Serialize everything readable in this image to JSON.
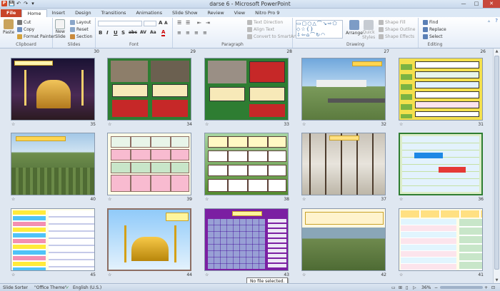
{
  "window": {
    "title": "darse 6  -  Microsoft PowerPoint"
  },
  "qat": [
    "P",
    "💾",
    "↶",
    "↷",
    "▾"
  ],
  "tabs": [
    "File",
    "Home",
    "Insert",
    "Design",
    "Transitions",
    "Animations",
    "Slide Show",
    "Review",
    "View",
    "Nitro Pro 9"
  ],
  "ribbon": {
    "clipboard": {
      "paste": "Paste",
      "cut": "Cut",
      "copy": "Copy",
      "format_painter": "Format Painter",
      "label": "Clipboard"
    },
    "slides": {
      "new_slide": "New",
      "new_slide2": "Slide",
      "layout": "Layout",
      "reset": "Reset",
      "section": "Section",
      "label": "Slides"
    },
    "font": {
      "bold": "B",
      "italic": "I",
      "underline": "U",
      "shadow": "S",
      "strike": "abc",
      "spacing": "AV",
      "case": "Aa",
      "color": "A",
      "label": "Font"
    },
    "paragraph": {
      "text_direction": "Text Direction",
      "align_text": "Align Text",
      "smartart": "Convert to SmartArt",
      "label": "Paragraph"
    },
    "drawing": {
      "arrange": "Arrange",
      "quick_styles": "Quick",
      "quick_styles2": "Styles",
      "shape_fill": "Shape Fill",
      "shape_outline": "Shape Outline",
      "shape_effects": "Shape Effects",
      "label": "Drawing"
    },
    "editing": {
      "find": "Find",
      "replace": "Replace",
      "select": "Select",
      "label": "Editing"
    }
  },
  "slides": [
    {
      "num": "26"
    },
    {
      "num": "27"
    },
    {
      "num": "28"
    },
    {
      "num": "29"
    },
    {
      "num": "30"
    },
    {
      "num": "31"
    },
    {
      "num": "32"
    },
    {
      "num": "33"
    },
    {
      "num": "34"
    },
    {
      "num": "35"
    },
    {
      "num": "36"
    },
    {
      "num": "37"
    },
    {
      "num": "38"
    },
    {
      "num": "39"
    },
    {
      "num": "40"
    },
    {
      "num": "41"
    },
    {
      "num": "42"
    },
    {
      "num": "43"
    },
    {
      "num": "44"
    },
    {
      "num": "45"
    }
  ],
  "tooltip": "No file selected.",
  "status": {
    "view": "Slide Sorter",
    "theme": "\"Office Theme\"",
    "language": "English (U.S.)",
    "zoom": "36%"
  },
  "colors": {
    "file_tab": "#c8452a",
    "ribbon_bg": "#e4ecf7",
    "sorter_bg": "#dfe7f1"
  }
}
